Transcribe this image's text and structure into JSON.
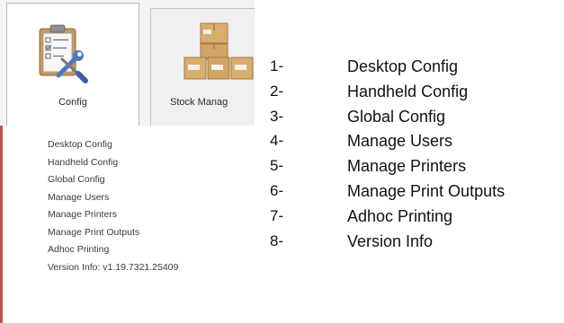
{
  "ribbon": {
    "tabs": [
      {
        "label": "Config",
        "icon": "config-tools-icon"
      },
      {
        "label": "Stock Manag",
        "icon": "stock-boxes-icon"
      }
    ]
  },
  "menu": {
    "items": [
      "Desktop Config",
      "Handheld Config",
      "Global Config",
      "Manage Users",
      "Manage Printers",
      "Manage Print Outputs",
      "Adhoc Printing",
      "Version Info: v1.19.7321.25409"
    ]
  },
  "legend": {
    "items": [
      {
        "num": "1-",
        "text": "Desktop Config"
      },
      {
        "num": "2-",
        "text": "Handheld Config"
      },
      {
        "num": "3-",
        "text": "Global Config"
      },
      {
        "num": "4-",
        "text": "Manage Users"
      },
      {
        "num": "5-",
        "text": "Manage Printers"
      },
      {
        "num": "6-",
        "text": "Manage Print Outputs"
      },
      {
        "num": "7-",
        "text": "Adhoc Printing"
      },
      {
        "num": "8-",
        "text": "Version Info"
      }
    ]
  },
  "colors": {
    "accent_bar": "#c0504d",
    "box_brown": "#d8ad6e",
    "tools_blue": "#4a78c2"
  }
}
